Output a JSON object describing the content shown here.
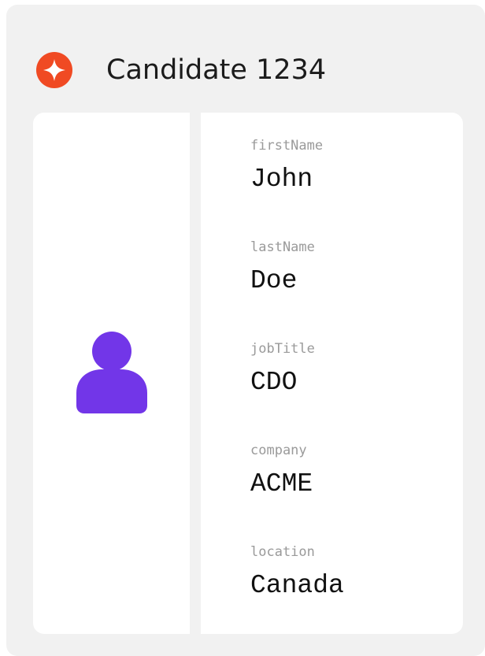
{
  "header": {
    "title": "Candidate 1234",
    "logo_icon": "sparkle-badge-icon",
    "logo_color": "#f04a23"
  },
  "profile": {
    "avatar_icon": "user-icon",
    "avatar_color": "#7236e8"
  },
  "fields": [
    {
      "label": "firstName",
      "value": "John"
    },
    {
      "label": "lastName",
      "value": "Doe"
    },
    {
      "label": "jobTitle",
      "value": "CDO"
    },
    {
      "label": "company",
      "value": "ACME"
    },
    {
      "label": "location",
      "value": "Canada"
    }
  ]
}
